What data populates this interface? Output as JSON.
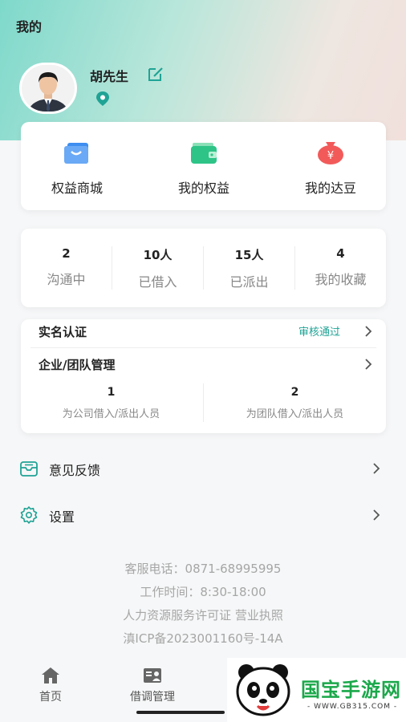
{
  "header": {
    "title": "我的"
  },
  "user": {
    "name": "胡先生"
  },
  "benefits": [
    {
      "label": "权益商城",
      "icon": "shopping-bag-icon",
      "color": "#3d8ef0"
    },
    {
      "label": "我的权益",
      "icon": "wallet-icon",
      "color": "#2ec487"
    },
    {
      "label": "我的达豆",
      "icon": "money-bag-icon",
      "color": "#f25a5a"
    }
  ],
  "stats": [
    {
      "value": "2",
      "label": "沟通中"
    },
    {
      "value": "10人",
      "label": "已借入"
    },
    {
      "value": "15人",
      "label": "已派出"
    },
    {
      "value": "4",
      "label": "我的收藏"
    }
  ],
  "verification": {
    "title": "实名认证",
    "status": "审核通过"
  },
  "org_management": {
    "title": "企业/团队管理",
    "items": [
      {
        "value": "1",
        "label": "为公司借入/派出人员"
      },
      {
        "value": "2",
        "label": "为团队借入/派出人员"
      }
    ]
  },
  "menu": [
    {
      "label": "意见反馈",
      "icon": "feedback-icon"
    },
    {
      "label": "设置",
      "icon": "gear-icon"
    }
  ],
  "footer": {
    "phone": "客服电话：0871-68995995",
    "hours": "工作时间：8:30-18:00",
    "license": "人力资源服务许可证 营业执照",
    "icp": "滇ICP备2023001160号-14A"
  },
  "tabs": [
    {
      "label": "首页",
      "icon": "home-icon"
    },
    {
      "label": "借调管理",
      "icon": "id-card-icon"
    }
  ],
  "watermark": {
    "text": "国宝手游网",
    "url": "- WWW.GB315.COM -"
  },
  "colors": {
    "accent": "#1fa395",
    "hero_start": "#7ed9cb",
    "hero_end": "#f1e0dc"
  }
}
